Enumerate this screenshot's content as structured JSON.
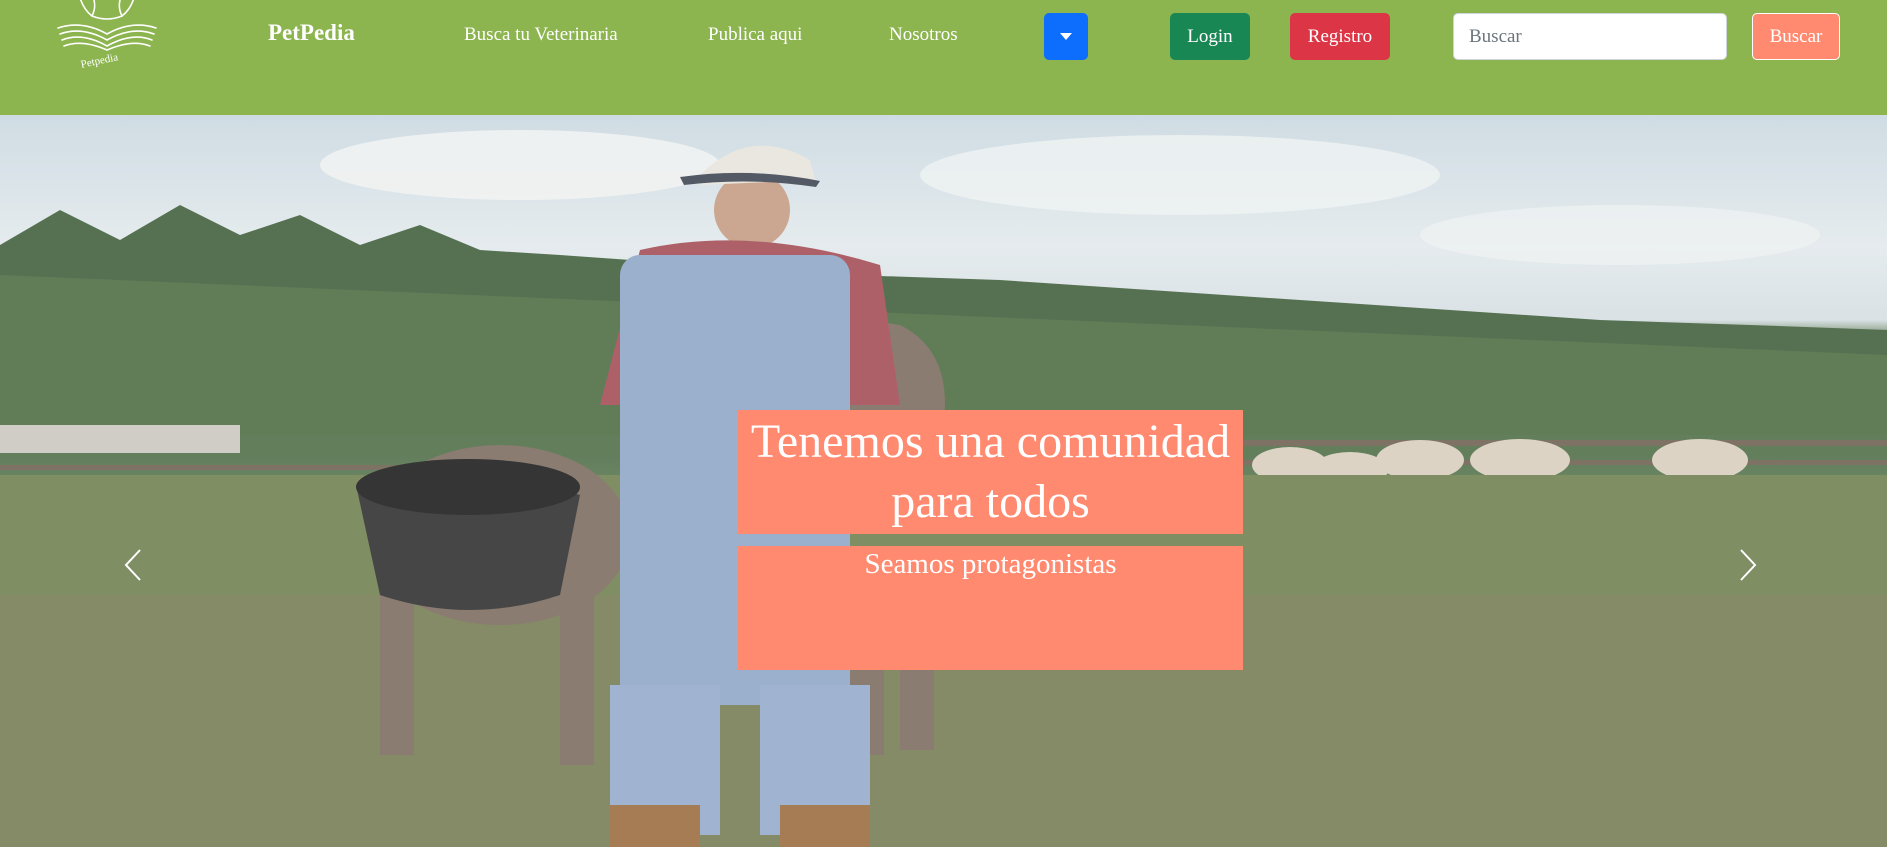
{
  "brand": {
    "logo_text": "Petpedia",
    "name": "PetPedia"
  },
  "nav": {
    "links": [
      "Busca tu Veterinaria",
      "Publica aqui",
      "Nosotros"
    ],
    "dropdown_icon": "caret-down-icon"
  },
  "auth": {
    "login_label": "Login",
    "register_label": "Registro"
  },
  "search": {
    "placeholder": "Buscar",
    "value": "",
    "button_label": "Buscar"
  },
  "hero": {
    "title": "Tenemos una comunidad para todos",
    "subtitle": "Seamos protagonistas",
    "prev_icon": "chevron-left-icon",
    "next_icon": "chevron-right-icon"
  },
  "colors": {
    "navbar": "#8cb44f",
    "caption": "#ff8a70",
    "dropdown": "#0d6efd",
    "login": "#198754",
    "register": "#dc3545",
    "search_button": "#ff8a70"
  }
}
